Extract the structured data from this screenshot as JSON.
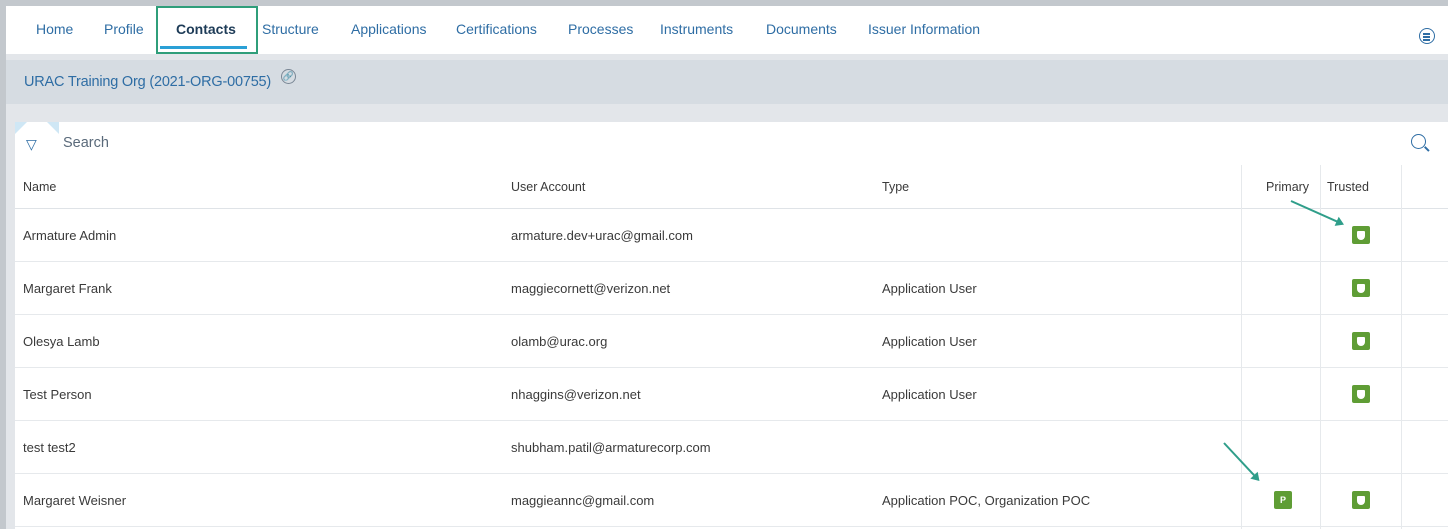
{
  "tabs": [
    {
      "label": "Home"
    },
    {
      "label": "Profile"
    },
    {
      "label": "Contacts"
    },
    {
      "label": "Structure"
    },
    {
      "label": "Applications"
    },
    {
      "label": "Certifications"
    },
    {
      "label": "Processes"
    },
    {
      "label": "Instruments"
    },
    {
      "label": "Documents"
    },
    {
      "label": "Issuer Information"
    }
  ],
  "active_tab": "Contacts",
  "org": {
    "title": "URAC Training Org (2021-ORG-00755)"
  },
  "search": {
    "placeholder": "Search"
  },
  "table": {
    "columns": [
      "Name",
      "User Account",
      "Type",
      "Primary",
      "Trusted"
    ],
    "rows": [
      {
        "name": "Armature Admin",
        "account": "armature.dev+urac@gmail.com",
        "type": "",
        "primary": false,
        "trusted": true
      },
      {
        "name": "Margaret Frank",
        "account": "maggiecornett@verizon.net",
        "type": "Application User",
        "primary": false,
        "trusted": true
      },
      {
        "name": "Olesya Lamb",
        "account": "olamb@urac.org",
        "type": "Application User",
        "primary": false,
        "trusted": true
      },
      {
        "name": "Test Person",
        "account": "nhaggins@verizon.net",
        "type": "Application User",
        "primary": false,
        "trusted": true
      },
      {
        "name": "test test2",
        "account": "shubham.patil@armaturecorp.com",
        "type": "",
        "primary": false,
        "trusted": false
      },
      {
        "name": "Margaret Weisner",
        "account": "maggieannc@gmail.com",
        "type": "Application POC, Organization POC",
        "primary": true,
        "trusted": true
      }
    ]
  },
  "primary_badge_text": "P",
  "colors": {
    "accent": "#2e6da4",
    "badge": "#5f9d35",
    "highlight": "#2f9e7a"
  }
}
